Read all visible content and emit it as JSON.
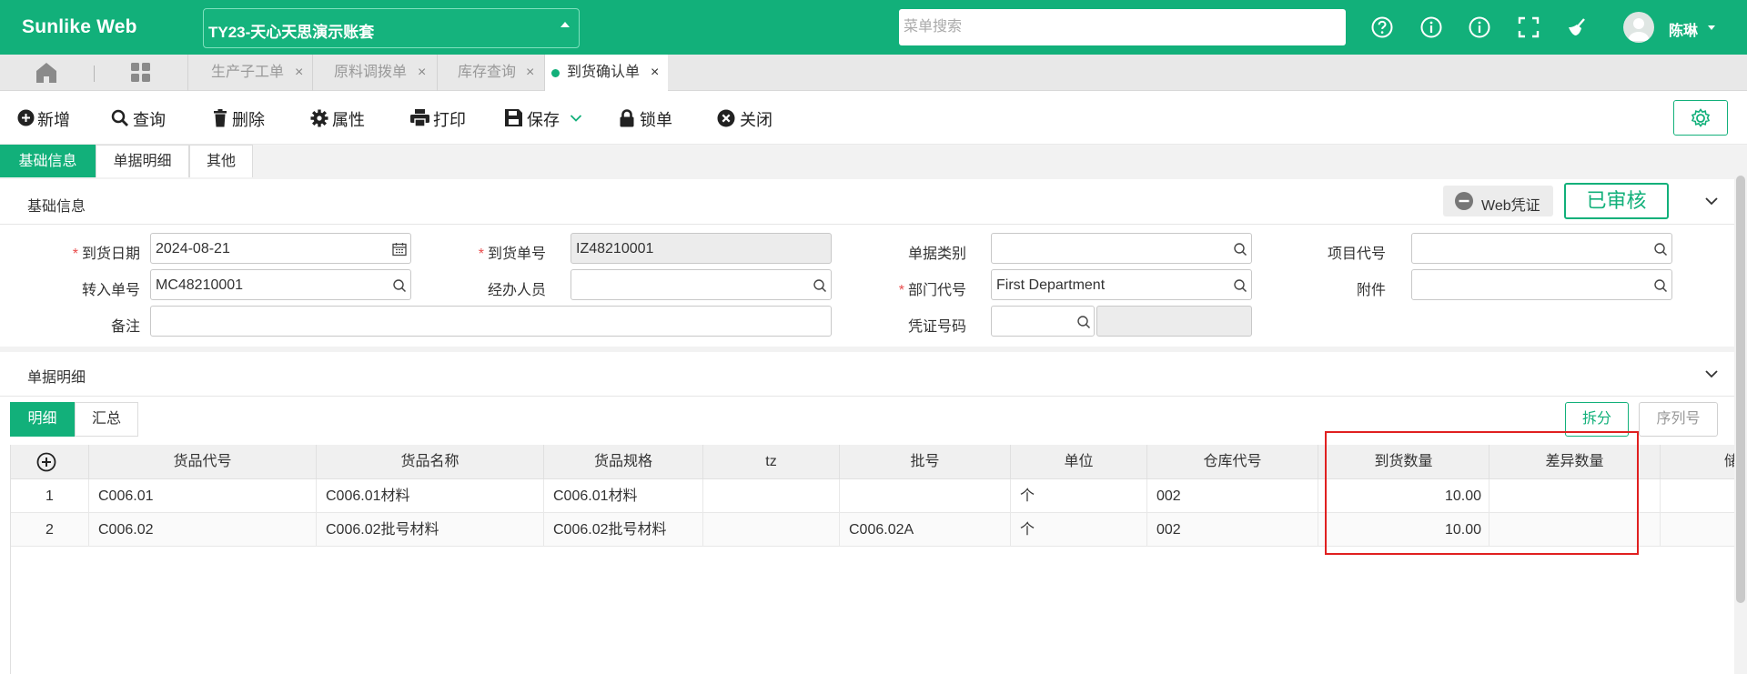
{
  "header": {
    "brand": "Sunlike Web",
    "account": "TY23-天心天思演示账套",
    "search_placeholder": "菜单搜索",
    "icons": [
      "question-circle-icon",
      "info-circle-icon",
      "info-circle-icon",
      "fullscreen-icon",
      "clean-brush-icon"
    ],
    "user": "陈琳"
  },
  "tabs": [
    {
      "label": "生产子工单",
      "active": false
    },
    {
      "label": "原料调拨单",
      "active": false
    },
    {
      "label": "库存查询",
      "active": false
    },
    {
      "label": "到货确认单",
      "active": true
    }
  ],
  "toolbar": {
    "add": "新增",
    "query": "查询",
    "delete": "删除",
    "properties": "属性",
    "print": "打印",
    "save": "保存",
    "lock": "锁单",
    "close": "关闭"
  },
  "section_tabs": [
    "基础信息",
    "单据明细",
    "其他"
  ],
  "basic": {
    "title": "基础信息",
    "web_voucher": "Web凭证",
    "status": "已审核",
    "fields": {
      "arrival_date": {
        "label": "到货日期",
        "value": "2024-08-21",
        "required": true
      },
      "arrival_no": {
        "label": "到货单号",
        "value": "IZ48210001",
        "required": true
      },
      "doc_type": {
        "label": "单据类别",
        "value": ""
      },
      "project_code": {
        "label": "项目代号",
        "value": ""
      },
      "transfer_no": {
        "label": "转入单号",
        "value": "MC48210001"
      },
      "handler": {
        "label": "经办人员",
        "value": ""
      },
      "dept_code": {
        "label": "部门代号",
        "value": "First Department",
        "required": true
      },
      "attachment": {
        "label": "附件",
        "value": ""
      },
      "remark": {
        "label": "备注",
        "value": ""
      },
      "voucher_no": {
        "label": "凭证号码",
        "value": ""
      }
    }
  },
  "detail": {
    "title": "单据明细",
    "sub_tabs": [
      "明细",
      "汇总"
    ],
    "split": "拆分",
    "serial": "序列号",
    "columns": [
      "货品代号",
      "货品名称",
      "货品规格",
      "tz",
      "批号",
      "单位",
      "仓库代号",
      "到货数量",
      "差异数量",
      "储"
    ],
    "rows": [
      {
        "no": "1",
        "code": "C006.01",
        "name": "C006.01材料",
        "spec": "C006.01材料",
        "tz": "",
        "batch": "",
        "unit": "个",
        "warehouse": "002",
        "qty": "10.00",
        "diff": ""
      },
      {
        "no": "2",
        "code": "C006.02",
        "name": "C006.02批号材料",
        "spec": "C006.02批号材料",
        "tz": "",
        "batch": "C006.02A",
        "unit": "个",
        "warehouse": "002",
        "qty": "10.00",
        "diff": ""
      }
    ]
  },
  "colors": {
    "accent": "#12b07a",
    "highlight": "#e02020",
    "required": "#e94c4c"
  }
}
